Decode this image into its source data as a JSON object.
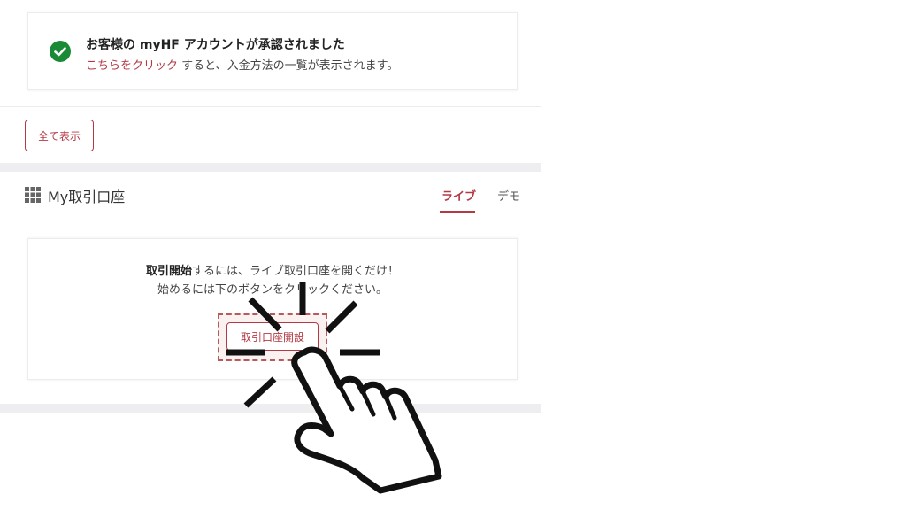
{
  "notification": {
    "title": "お客様の myHF アカウントが承認されました",
    "link_text": "こちらをクリック",
    "message_rest": " すると、入金方法の一覧が表示されます。"
  },
  "show_all_label": "全て表示",
  "accounts": {
    "title": "My取引口座",
    "tabs": [
      {
        "label": "ライブ",
        "active": true
      },
      {
        "label": "デモ",
        "active": false
      }
    ],
    "message_bold": "取引開始",
    "message_line1_rest": "するには、ライブ取引口座を開くだけ！",
    "message_line2": "始めるには下のボタンをクリックください。",
    "open_button_label": "取引口座開設"
  },
  "colors": {
    "accent": "#b33a45",
    "success": "#1a8a36",
    "panel_bg": "#eeeef1"
  },
  "icons": {
    "notice": "check-circle-icon",
    "accounts": "grid-icon",
    "overlay": "hand-pointer-icon"
  }
}
